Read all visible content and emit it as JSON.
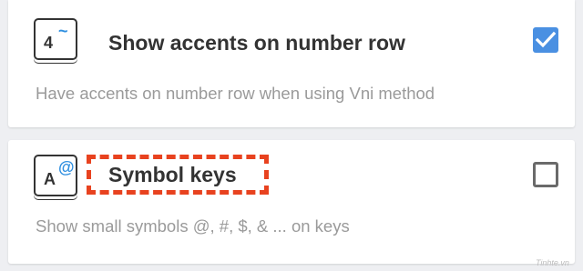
{
  "settings": [
    {
      "key_main": "4",
      "key_accent": "~",
      "title": "Show accents on number row",
      "description": "Have accents on number row when using Vni method",
      "checked": true
    },
    {
      "key_main": "A",
      "key_accent": "@",
      "title": "Symbol keys",
      "description": "Show small symbols @, #, $, & ... on keys",
      "checked": false
    }
  ],
  "colors": {
    "accent": "#4a90e2",
    "highlight": "#e8421f"
  },
  "watermark": "Tinhte.vn"
}
